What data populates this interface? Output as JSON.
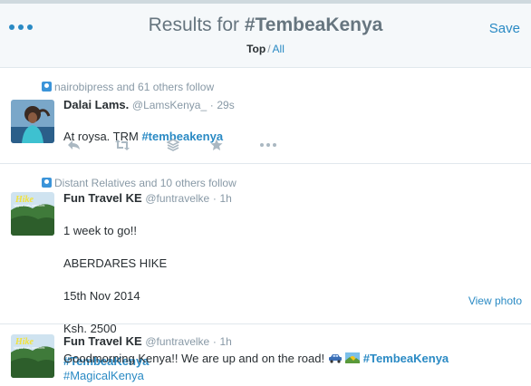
{
  "header": {
    "title_prefix": "Results for ",
    "title_hashtag": "#TembeaKenya",
    "save_label": "Save",
    "filter_top": "Top",
    "filter_separator": "/",
    "filter_all": "All"
  },
  "tweets": [
    {
      "context": "nairobipress and 61 others follow",
      "name": "Dalai Lams.",
      "handle": "@LamsKenya_",
      "time": "29s",
      "text": "At roysa. TRM ",
      "hashtag": "#tembeakenya"
    },
    {
      "context": "Distant Relatives and 10 others follow",
      "name": "Fun Travel KE",
      "handle": "@funtravelke",
      "time": "1h",
      "text_lines": [
        "1 week to go!!",
        "ABERDARES HIKE",
        "15th Nov 2014",
        "Ksh. 2500"
      ],
      "hashtag": "#TembeaKenya",
      "view_photo": "View photo",
      "avatar_text": "Hike",
      "avatar_subtext": "Magical trails, memories"
    },
    {
      "name": "Fun Travel KE",
      "handle": "@funtravelke",
      "time": "1h",
      "text": "Goodmorning Kenya!! We are up and on the road! ",
      "hashtag": "#TembeaKenya",
      "hashtag2": "#MagicalKenya",
      "avatar_text": "Hike",
      "avatar_subtext": "Magical trails, memories"
    }
  ],
  "icons": [
    "menu-dots-icon",
    "reply-icon",
    "retweet-icon",
    "stack-icon",
    "star-icon",
    "more-icon",
    "follow-context-icon"
  ],
  "colors": {
    "accent": "#2a8ac4",
    "muted": "#8899a6",
    "text": "#292f33",
    "header_bg": "#f5f8fa"
  }
}
